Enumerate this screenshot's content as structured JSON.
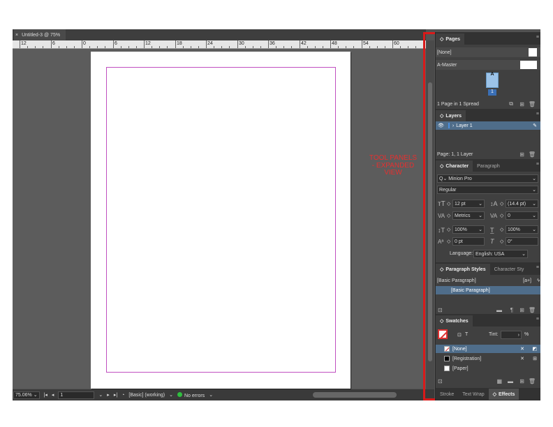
{
  "document": {
    "tab_title": "Untitled-3 @ 75%",
    "close_glyph": "×",
    "ruler_labels": [
      "12",
      "6",
      "0",
      "6",
      "12",
      "18",
      "24",
      "30",
      "36",
      "42",
      "48",
      "54",
      "60"
    ]
  },
  "status_bar": {
    "zoom": "75.06%",
    "page": "1",
    "preflight_profile": "[Basic] (working)",
    "errors": "No errors"
  },
  "annotation": {
    "text": "TOOL PANELS - EXPANDED VIEW",
    "color": "#e53030"
  },
  "pages_panel": {
    "tab": "Pages",
    "none_label": "[None]",
    "master_label": "A-Master",
    "master_letter": "A",
    "page_number": "1",
    "footer": "1 Page in 1 Spread"
  },
  "layers_panel": {
    "tab": "Layers",
    "layer_name": "Layer 1",
    "footer": "Page: 1, 1 Layer"
  },
  "character_panel": {
    "tabs": [
      "Character",
      "Paragraph"
    ],
    "font_family": "Minion Pro",
    "font_style": "Regular",
    "size": "12 pt",
    "leading": "(14.4 pt)",
    "kerning": "Metrics",
    "tracking": "0",
    "vscale": "100%",
    "hscale": "100%",
    "baseline": "0 pt",
    "skew": "0°",
    "language_label": "Language:",
    "language": "English: USA"
  },
  "paragraph_styles_panel": {
    "tabs": [
      "Paragraph Styles",
      "Character Sty"
    ],
    "current": "[Basic Paragraph]",
    "current_suffix": "[a+]",
    "items": [
      "[Basic Paragraph]"
    ]
  },
  "swatches_panel": {
    "tab": "Swatches",
    "tint_label": "Tint:",
    "tint_suffix": "%",
    "items": [
      {
        "name": "[None]",
        "color": "#ffffff"
      },
      {
        "name": "[Registration]",
        "color": "#000000"
      },
      {
        "name": "[Paper]",
        "color": "#ffffff"
      }
    ]
  },
  "bottom_tabs": [
    "Stroke",
    "Text Wrap",
    "Effects"
  ],
  "colors": {
    "accent_blue": "#4f6d8a",
    "margin_guide": "#c04fc0",
    "frame_red": "#d91a1a"
  }
}
